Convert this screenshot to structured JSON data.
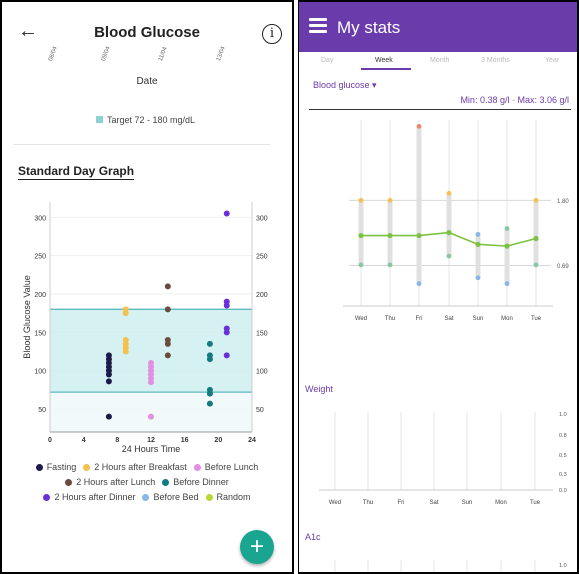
{
  "left": {
    "header": {
      "title": "Blood Glucose",
      "back_icon": "arrow-left-icon",
      "info_icon": "info-icon"
    },
    "date_ticks": [
      "08/04",
      "09/04",
      "11/04",
      "13/04"
    ],
    "date_label": "Date",
    "target_label": "Target 72 - 180 mg/dL",
    "section_title": "Standard Day Graph",
    "fab_label": "+",
    "colors": {
      "target_band": "#c8ecee",
      "target_line": "#5bb9bf",
      "accent": "#1aa590",
      "fasting": "#1c1b4a",
      "after_breakfast": "#f2c14e",
      "before_lunch": "#e38ee0",
      "after_lunch": "#6b4b3e",
      "before_dinner": "#127a80",
      "after_dinner": "#6a2fd6",
      "before_bed": "#87b6e8",
      "random": "#b5d832"
    },
    "legend": [
      [
        {
          "key": "fasting",
          "label": "Fasting"
        },
        {
          "key": "after_breakfast",
          "label": "2 Hours after Breakfast"
        },
        {
          "key": "before_lunch",
          "label": "Before Lunch"
        }
      ],
      [
        {
          "key": "after_lunch",
          "label": "2 Hours after Lunch"
        },
        {
          "key": "before_dinner",
          "label": "Before Dinner"
        }
      ],
      [
        {
          "key": "after_dinner",
          "label": "2 Hours after Dinner"
        },
        {
          "key": "before_bed",
          "label": "Before Bed"
        },
        {
          "key": "random",
          "label": "Random"
        }
      ]
    ],
    "chart_data": {
      "type": "scatter",
      "title": "Standard Day Graph",
      "xlabel": "24 Hours Time",
      "ylabel": "Blood Glucose Value",
      "xlim": [
        0,
        24
      ],
      "ylim": [
        20,
        320
      ],
      "xticks": [
        0,
        4,
        8,
        12,
        16,
        20,
        24
      ],
      "yticks": [
        50,
        100,
        150,
        200,
        250,
        300
      ],
      "target_range": [
        72,
        180
      ],
      "series": [
        {
          "key": "fasting",
          "name": "Fasting",
          "points": [
            [
              7,
              40
            ],
            [
              7,
              86
            ],
            [
              7,
              95
            ],
            [
              7,
              100
            ],
            [
              7,
              105
            ],
            [
              7,
              110
            ],
            [
              7,
              115
            ],
            [
              7,
              120
            ]
          ]
        },
        {
          "key": "after_breakfast",
          "name": "2 Hours after Breakfast",
          "points": [
            [
              9,
              125
            ],
            [
              9,
              130
            ],
            [
              9,
              135
            ],
            [
              9,
              140
            ],
            [
              9,
              175
            ],
            [
              9,
              180
            ]
          ]
        },
        {
          "key": "before_lunch",
          "name": "Before Lunch",
          "points": [
            [
              12,
              40
            ],
            [
              12,
              85
            ],
            [
              12,
              90
            ],
            [
              12,
              95
            ],
            [
              12,
              100
            ],
            [
              12,
              105
            ],
            [
              12,
              110
            ]
          ]
        },
        {
          "key": "after_lunch",
          "name": "2 Hours after Lunch",
          "points": [
            [
              14,
              120
            ],
            [
              14,
              135
            ],
            [
              14,
              140
            ],
            [
              14,
              180
            ],
            [
              14,
              210
            ]
          ]
        },
        {
          "key": "before_dinner",
          "name": "Before Dinner",
          "points": [
            [
              19,
              57
            ],
            [
              19,
              70
            ],
            [
              19,
              75
            ],
            [
              19,
              115
            ],
            [
              19,
              120
            ],
            [
              19,
              135
            ]
          ]
        },
        {
          "key": "after_dinner",
          "name": "2 Hours after Dinner",
          "points": [
            [
              21,
              120
            ],
            [
              21,
              150
            ],
            [
              21,
              155
            ],
            [
              21,
              185
            ],
            [
              21,
              190
            ],
            [
              21,
              305
            ]
          ]
        }
      ]
    }
  },
  "right": {
    "header": {
      "title": "My stats",
      "menu_icon": "hamburger-menu-icon"
    },
    "tabs": [
      "Day",
      "Week",
      "Month",
      "3 Months",
      "Year"
    ],
    "active_tab": "Week",
    "metric_selector": "Blood glucose ▾",
    "min_max": {
      "min": "Min: 0.38 g/l",
      "separator": " - ",
      "max": "Max: 3.06 g/l"
    },
    "colors": {
      "brand": "#6a3cab",
      "line": "#7cc242",
      "range_bar": "#e0e0e0",
      "high": "#f2c14e",
      "low": "#86c7a2",
      "very_high": "#e98a6f",
      "very_low": "#87b6e8"
    },
    "chart_data": [
      {
        "type": "line",
        "title": "Blood glucose",
        "categories": [
          "Wed",
          "Thu",
          "Fri",
          "Sat",
          "Sun",
          "Mon",
          "Tue"
        ],
        "ylim": [
          0.0,
          3.1
        ],
        "reference_lines": [
          1.8,
          0.69
        ],
        "series": [
          {
            "name": "average",
            "values": [
              1.2,
              1.2,
              1.2,
              1.25,
              1.05,
              1.02,
              1.15
            ]
          }
        ],
        "ranges": [
          {
            "min": 0.69,
            "max": 1.8
          },
          {
            "min": 0.69,
            "max": 1.8
          },
          {
            "min": 0.38,
            "max": 3.06
          },
          {
            "min": 0.82,
            "max": 1.92
          },
          {
            "min": 0.45,
            "max": 1.22
          },
          {
            "min": 0.38,
            "max": 1.32
          },
          {
            "min": 0.69,
            "max": 1.8
          }
        ],
        "markers": [
          {
            "cat": 0,
            "value": 1.8,
            "kind": "high"
          },
          {
            "cat": 0,
            "value": 0.7,
            "kind": "low"
          },
          {
            "cat": 1,
            "value": 1.8,
            "kind": "high"
          },
          {
            "cat": 1,
            "value": 0.7,
            "kind": "low"
          },
          {
            "cat": 2,
            "value": 3.06,
            "kind": "very_high"
          },
          {
            "cat": 2,
            "value": 0.38,
            "kind": "very_low"
          },
          {
            "cat": 3,
            "value": 1.92,
            "kind": "high"
          },
          {
            "cat": 3,
            "value": 0.85,
            "kind": "low"
          },
          {
            "cat": 4,
            "value": 1.22,
            "kind": "very_low"
          },
          {
            "cat": 4,
            "value": 0.48,
            "kind": "very_low"
          },
          {
            "cat": 5,
            "value": 1.32,
            "kind": "low"
          },
          {
            "cat": 5,
            "value": 0.38,
            "kind": "very_low"
          },
          {
            "cat": 6,
            "value": 1.8,
            "kind": "high"
          },
          {
            "cat": 6,
            "value": 0.7,
            "kind": "low"
          }
        ],
        "tick_labels": [
          "1.80",
          "0.69"
        ]
      },
      {
        "type": "line",
        "title": "Weight",
        "categories": [
          "Wed",
          "Thu",
          "Fri",
          "Sat",
          "Sun",
          "Mon",
          "Tue"
        ],
        "yticks": [
          "1.0",
          "0.8",
          "0.5",
          "0.3",
          "0.0"
        ],
        "series": []
      },
      {
        "type": "line",
        "title": "A1c",
        "yticks": [
          "1.0"
        ],
        "series": []
      }
    ],
    "weight_label": "Weight",
    "a1c_label": "A1c"
  }
}
